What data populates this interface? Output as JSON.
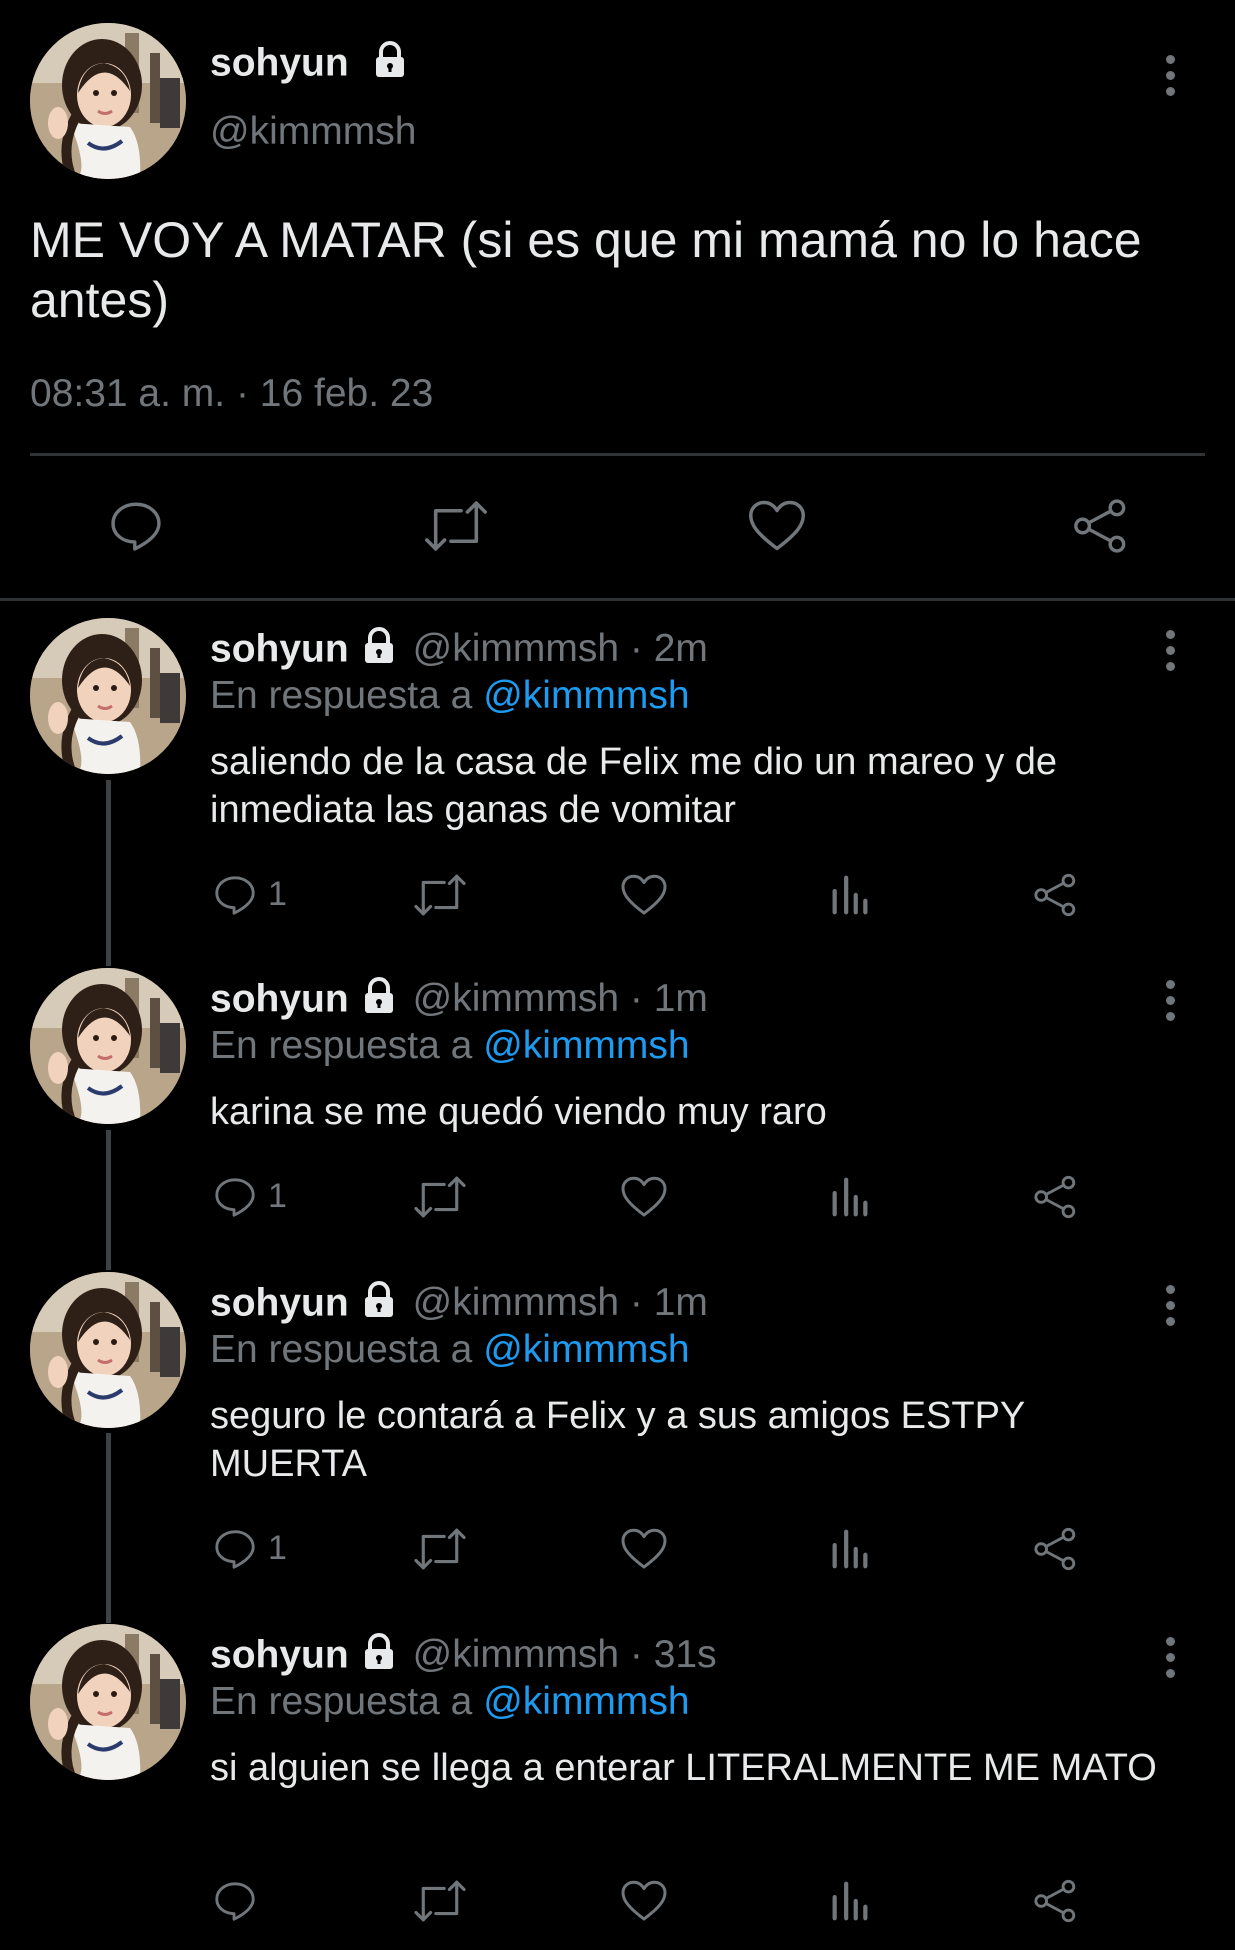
{
  "main_tweet": {
    "name": "sohyun",
    "handle": "@kimmmsh",
    "text": "ME VOY A MATAR (si es que mi mamá no lo hace antes)",
    "timestamp": "08:31 a. m. · 16 feb. 23",
    "locked": true
  },
  "reply_prefix": "En respuesta a",
  "replies": [
    {
      "name": "sohyun",
      "handle": "@kimmmsh · 2m",
      "mention": "@kimmmsh",
      "text": "saliendo de la casa de Felix me dio un mareo y de inmediata las ganas de vomitar",
      "reply_count": "1"
    },
    {
      "name": "sohyun",
      "handle": "@kimmmsh · 1m",
      "mention": "@kimmmsh",
      "text": "karina se me quedó viendo muy raro",
      "reply_count": "1"
    },
    {
      "name": "sohyun",
      "handle": "@kimmmsh · 1m",
      "mention": "@kimmmsh",
      "text": "seguro le contará a Felix y a sus amigos ESTPY MUERTA",
      "reply_count": "1"
    },
    {
      "name": "sohyun",
      "handle": "@kimmmsh · 31s",
      "mention": "@kimmmsh",
      "text": "si alguien se llega a enterar LITERALMENTE ME MATO",
      "reply_count": ""
    }
  ],
  "colors": {
    "background": "#000000",
    "text": "#e7e9ea",
    "muted": "#71767b",
    "link": "#1d9bf0"
  },
  "icons": [
    "lock-icon",
    "more-icon",
    "reply-icon",
    "retweet-icon",
    "like-icon",
    "views-icon",
    "share-icon"
  ]
}
